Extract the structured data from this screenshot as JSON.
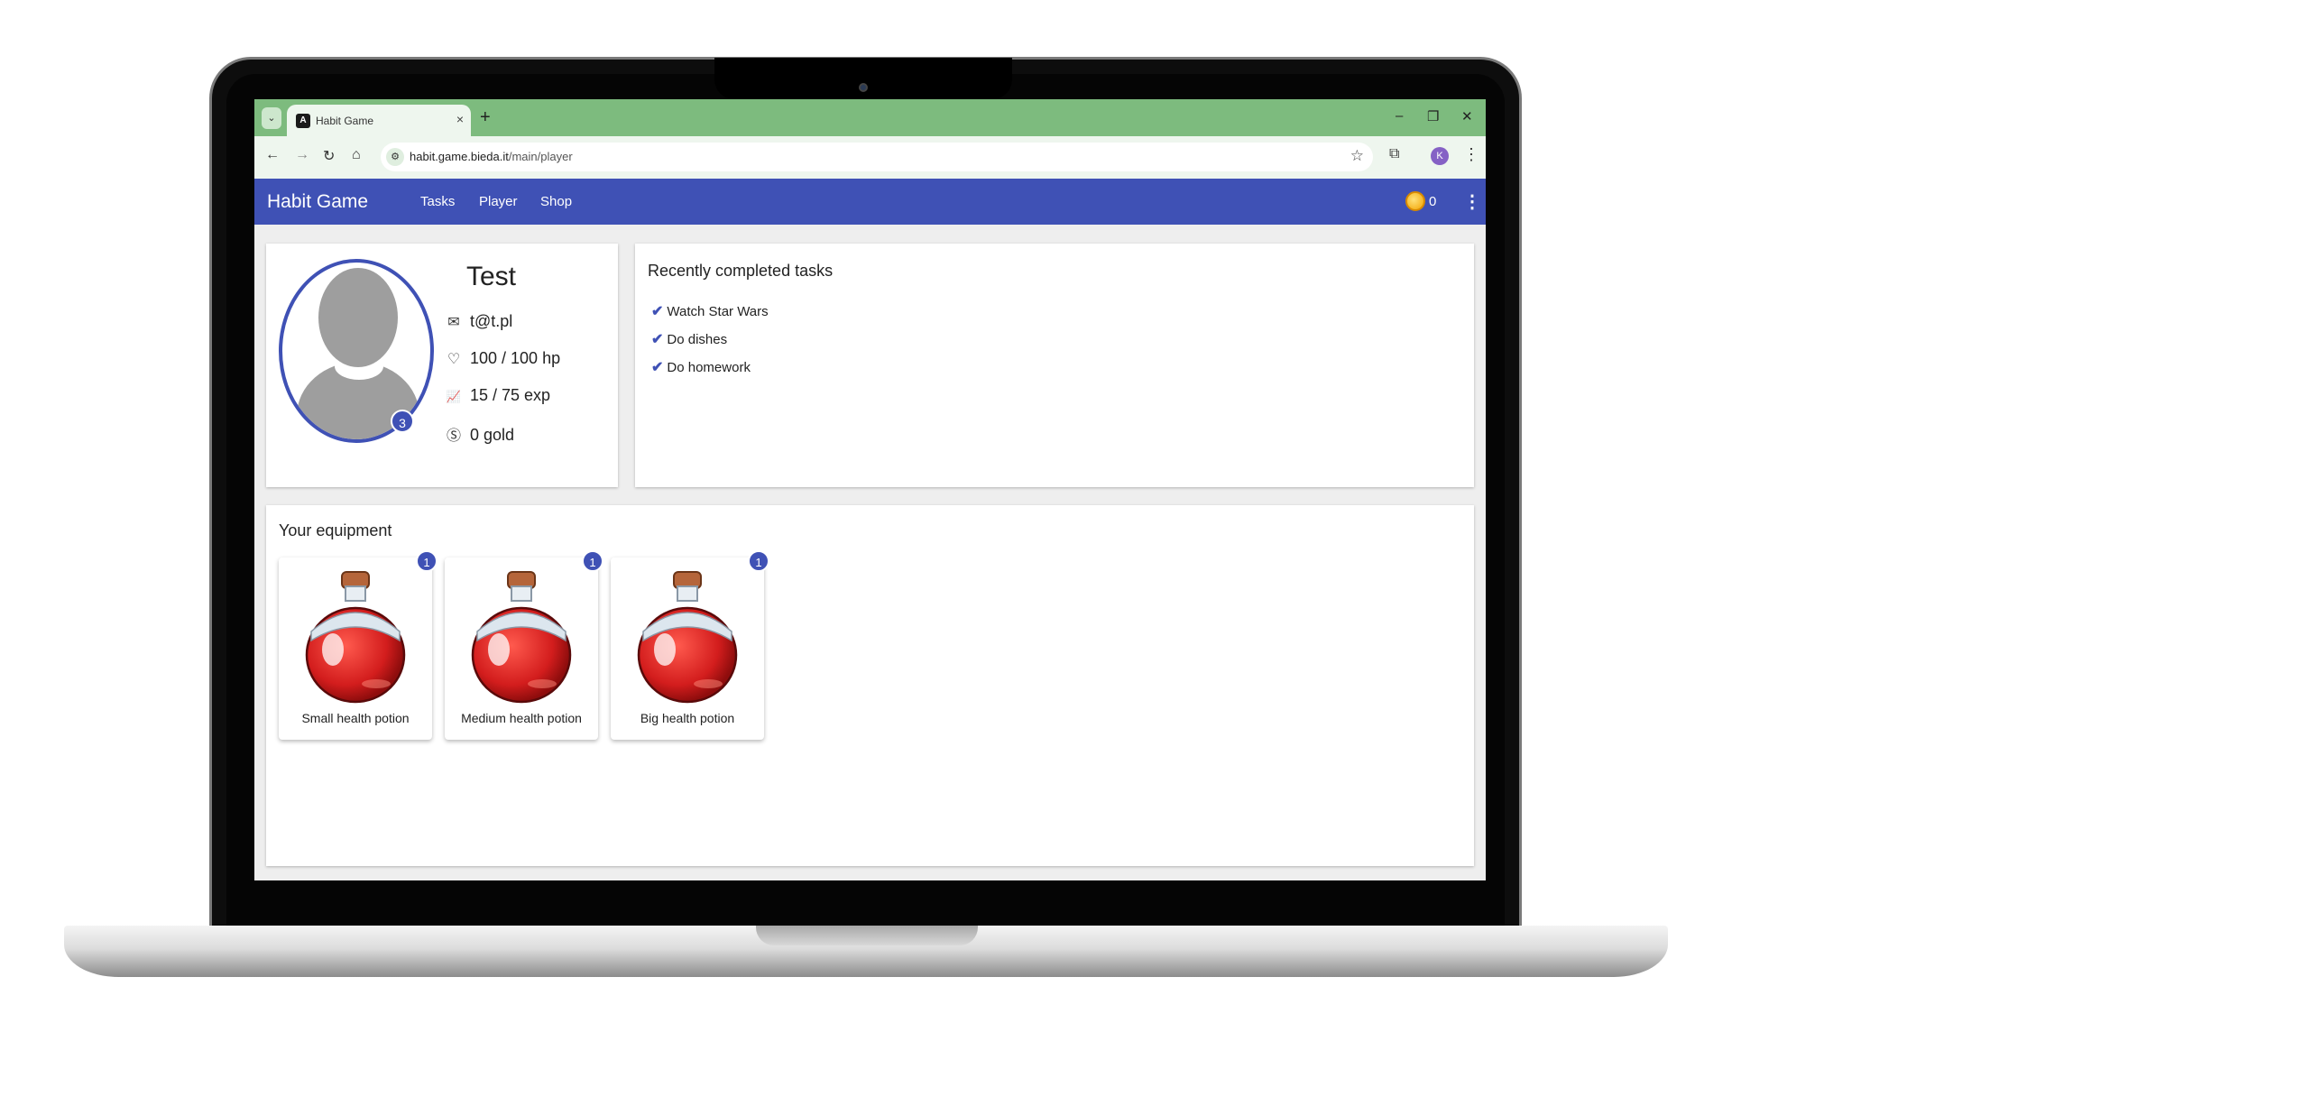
{
  "browser": {
    "tab_title": "Habit Game",
    "tab_close": "×",
    "new_tab": "+",
    "tab_menu": "⌄",
    "window_controls": {
      "minimize": "–",
      "restore": "❐",
      "close": "✕"
    },
    "nav": {
      "back": "←",
      "forward": "→",
      "reload": "↻",
      "home": "⌂"
    },
    "url_host": "habit.game.bieda.it",
    "url_path": "/main/player",
    "bookmark_icon": "☆",
    "extensions_icon": "⧉",
    "profile_initial": "K",
    "menu_icon": "⋮"
  },
  "app": {
    "title": "Habit Game",
    "nav": [
      "Tasks",
      "Player",
      "Shop"
    ],
    "gold": "0",
    "menu_icon": "⋮",
    "accent_color": "#3f51b5"
  },
  "player": {
    "name": "Test",
    "level": "3",
    "email": "t@t.pl",
    "hp": "100 / 100 hp",
    "exp": "15 / 75 exp",
    "gold": "0 gold",
    "icons": {
      "email": "✉",
      "hp": "♡",
      "exp": "📈",
      "gold": "Ⓢ"
    }
  },
  "tasks": {
    "heading": "Recently completed tasks",
    "check_icon": "✔",
    "items": [
      "Watch Star Wars",
      "Do dishes",
      "Do homework"
    ]
  },
  "equipment": {
    "heading": "Your equipment",
    "items": [
      {
        "name": "Small health potion",
        "count": "1"
      },
      {
        "name": "Medium health potion",
        "count": "1"
      },
      {
        "name": "Big health potion",
        "count": "1"
      }
    ]
  }
}
